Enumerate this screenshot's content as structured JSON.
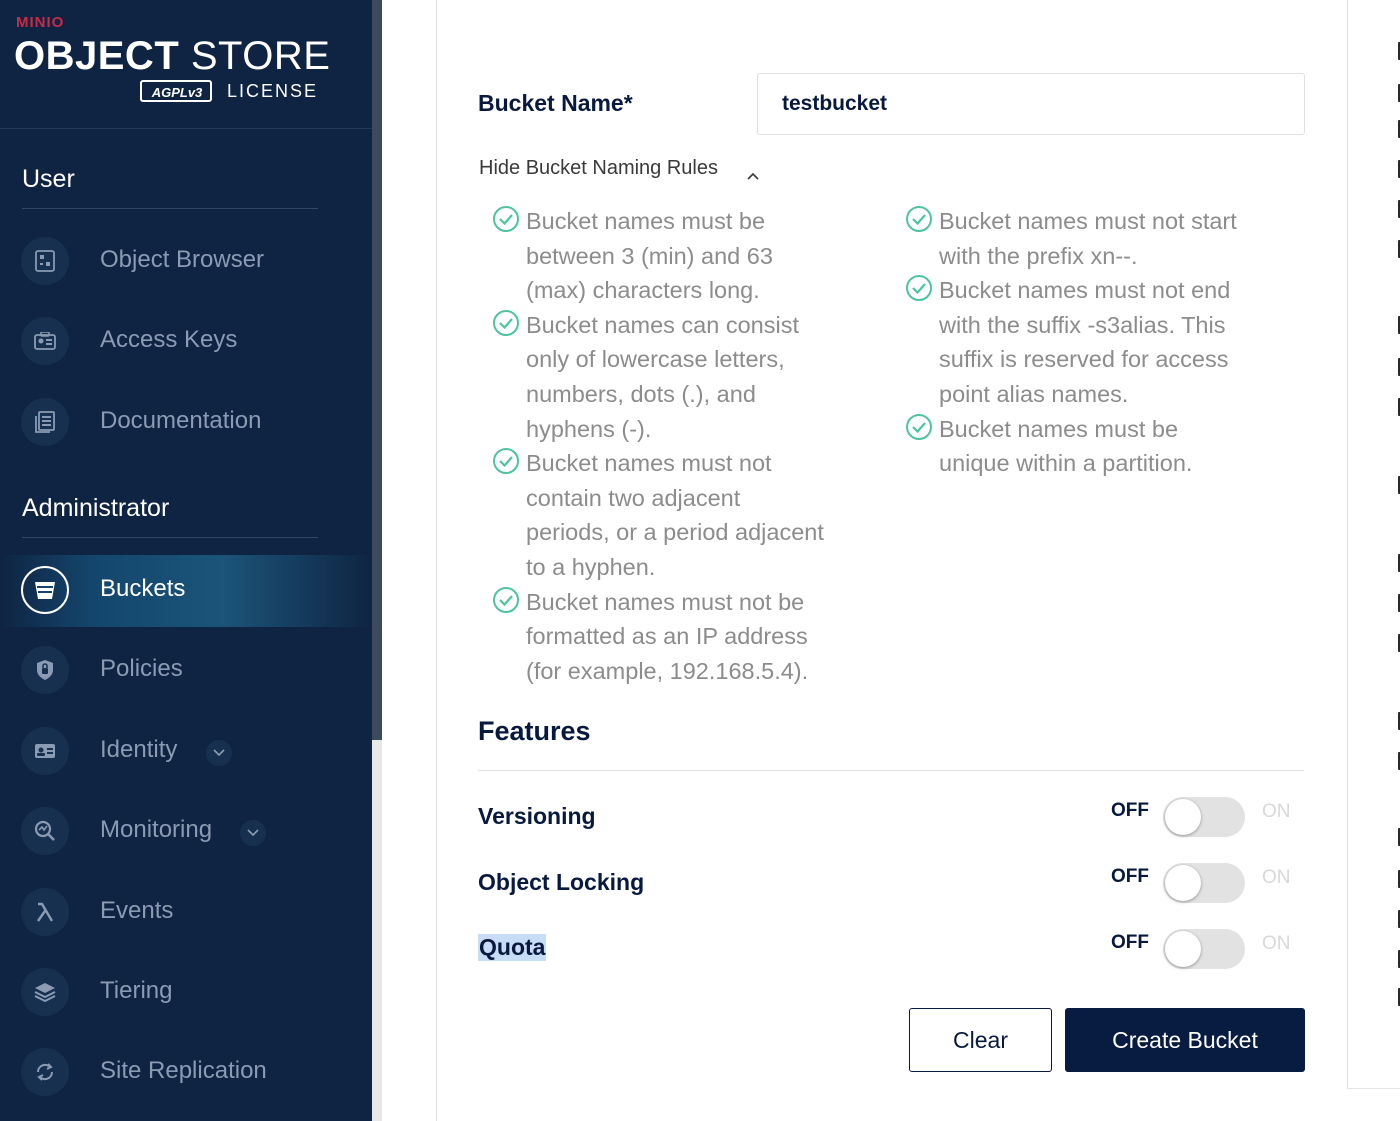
{
  "brand": {
    "product": "MINIO",
    "title_bold": "OBJECT",
    "title_light": "STORE",
    "badge": "AGPLv3",
    "license": "LICENSE"
  },
  "sidebar": {
    "user_heading": "User",
    "user_items": [
      {
        "label": "Object Browser",
        "icon": "object-browser-icon"
      },
      {
        "label": "Access Keys",
        "icon": "access-keys-icon"
      },
      {
        "label": "Documentation",
        "icon": "documentation-icon"
      }
    ],
    "admin_heading": "Administrator",
    "admin_items": [
      {
        "label": "Buckets",
        "icon": "bucket-icon",
        "active": true
      },
      {
        "label": "Policies",
        "icon": "policies-icon"
      },
      {
        "label": "Identity",
        "icon": "identity-icon",
        "expandable": true
      },
      {
        "label": "Monitoring",
        "icon": "monitoring-icon",
        "expandable": true
      },
      {
        "label": "Events",
        "icon": "lambda-icon"
      },
      {
        "label": "Tiering",
        "icon": "tiering-icon"
      },
      {
        "label": "Site Replication",
        "icon": "site-replication-icon"
      }
    ]
  },
  "form": {
    "bucket_name_label": "Bucket Name*",
    "bucket_name_value": "testbucket",
    "rules_toggle": "Hide Bucket Naming Rules",
    "rules_left": [
      "Bucket names must be between 3 (min) and 63 (max) characters long.",
      "Bucket names can consist only of lowercase letters, numbers, dots (.), and hyphens (-).",
      "Bucket names must not contain two adjacent periods, or a period adjacent to a hyphen.",
      "Bucket names must not be formatted as an IP address (for example, 192.168.5.4)."
    ],
    "rules_right": [
      "Bucket names must not start with the prefix xn--.",
      "Bucket names must not end with the suffix -s3alias. This suffix is reserved for access point alias names.",
      "Bucket names must be unique within a partition."
    ],
    "features_title": "Features",
    "features": [
      {
        "label": "Versioning",
        "off": "OFF",
        "on": "ON",
        "enabled": false
      },
      {
        "label": "Object Locking",
        "off": "OFF",
        "on": "ON",
        "enabled": false
      },
      {
        "label": "Quota",
        "off": "OFF",
        "on": "ON",
        "enabled": false
      }
    ],
    "clear_label": "Clear",
    "create_label": "Create Bucket"
  },
  "colors": {
    "sidebar_bg": "#0f2442",
    "primary": "#081c42",
    "check_green": "#4cc59a",
    "muted_text": "#8c8c8c"
  }
}
